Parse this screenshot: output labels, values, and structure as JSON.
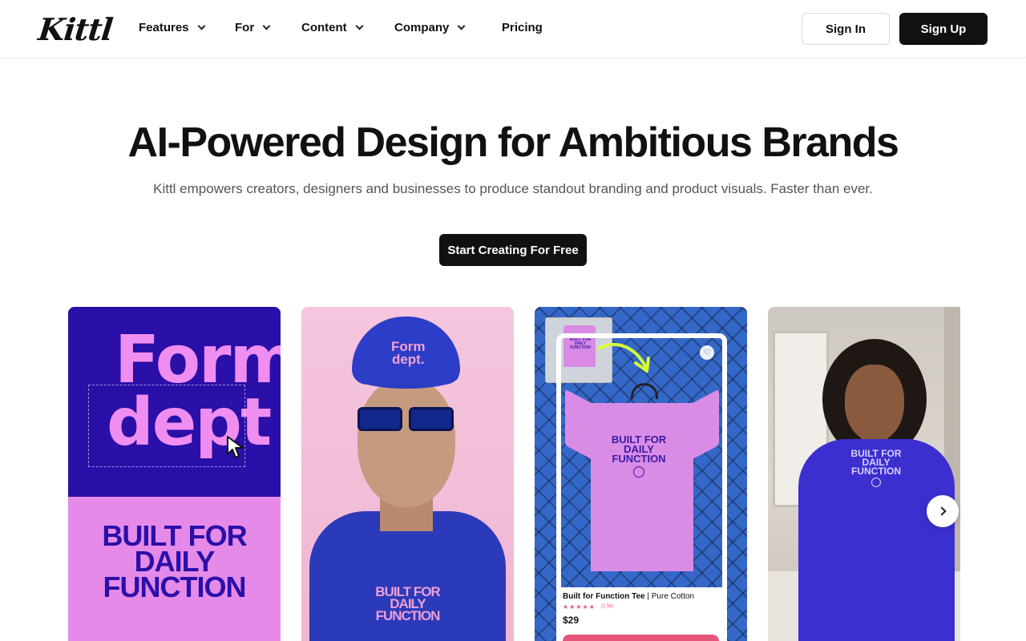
{
  "header": {
    "logo": "Kittl",
    "nav": [
      {
        "label": "Features",
        "has_dropdown": true
      },
      {
        "label": "For",
        "has_dropdown": true
      },
      {
        "label": "Content",
        "has_dropdown": true
      },
      {
        "label": "Company",
        "has_dropdown": true
      },
      {
        "label": "Pricing",
        "has_dropdown": false
      }
    ],
    "sign_in": "Sign In",
    "sign_up": "Sign Up"
  },
  "hero": {
    "title": "AI-Powered Design for Ambitious Brands",
    "subtitle": "Kittl empowers creators, designers and businesses to produce standout branding and product visuals. Faster than ever.",
    "cta": "Start Creating For Free"
  },
  "carousel": {
    "card1": {
      "logo_line1": "Form",
      "logo_line2": "dept",
      "slogan": [
        "BUILT FOR",
        "DAILY",
        "FUNCTION"
      ]
    },
    "card2": {
      "cap_text": [
        "Form",
        "dept."
      ],
      "slogan": [
        "BUILT FOR",
        "DAILY",
        "FUNCTION"
      ]
    },
    "card3": {
      "thumb_text": [
        "BUILT FOR",
        "DAILY",
        "FUNCTION"
      ],
      "slogan": [
        "BUILT FOR",
        "DAILY",
        "FUNCTION"
      ],
      "product_name": "Built for Function Tee",
      "product_variant": "| Pure Cotton",
      "stars": "★★★★★",
      "reviews": "(1.5k)",
      "price": "$29"
    },
    "card4": {
      "slogan": [
        "BUILT FOR",
        "DAILY",
        "FUNCTION"
      ]
    }
  },
  "colors": {
    "brand_dark": "#111111",
    "purple": "#2a0fa8",
    "pink": "#e58ae8",
    "accent_pink": "#e8557c"
  }
}
